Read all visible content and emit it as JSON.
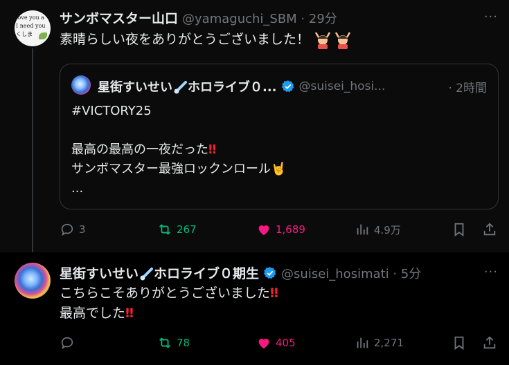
{
  "post1": {
    "name": "サンボマスター山口",
    "handle": "@yamaguchi_SBM · 29分",
    "more": "···",
    "text": "素晴らしい夜をありがとうございました！",
    "avatar_text": [
      "love you a",
      "I need you",
      "くしま"
    ],
    "quote": {
      "name_part1": "星街すいせい",
      "name_part2": "ホロライブ０...",
      "handle": "@suisei_hosi...",
      "time": "· 2時間",
      "line1": "#VICTORY25",
      "line2": "最高の最高の一夜だった",
      "line3": "サンボマスター最強ロックンロール",
      "line4": "..."
    },
    "actions": {
      "reply": "3",
      "retweet": "267",
      "like": "1,689",
      "views": "4.9万"
    }
  },
  "post2": {
    "name_part1": "星街すいせい",
    "name_part2": "ホロライブ０期生",
    "handle": "@suisei_hosimati · 5分",
    "more": "···",
    "line1": "こちらこそありがとうございました",
    "line2": "最高でした",
    "actions": {
      "reply": "",
      "retweet": "78",
      "like": "405",
      "views": "2,271"
    }
  },
  "colors": {
    "background": "#000000",
    "text": "#e7e9ea",
    "secondary": "#71767b",
    "retweet": "#00ba7c",
    "like": "#f91880",
    "verified": "#1d9bf0"
  }
}
